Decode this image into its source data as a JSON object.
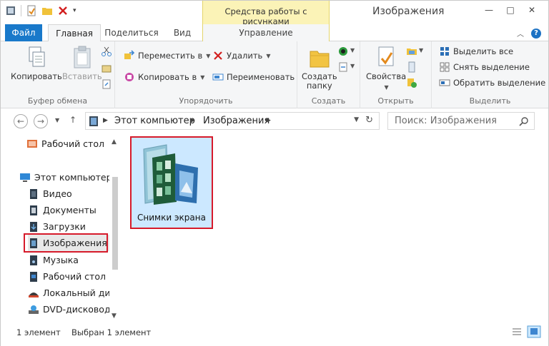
{
  "window": {
    "title": "Изображения"
  },
  "context_tab": {
    "title": "Средства работы с рисунками",
    "tab_label": "Управление"
  },
  "ribbon_tabs": {
    "file": "Файл",
    "home": "Главная",
    "share": "Поделиться",
    "view": "Вид"
  },
  "clipboard": {
    "label": "Буфер обмена",
    "copy": "Копировать",
    "paste": "Вставить"
  },
  "organize": {
    "label": "Упорядочить",
    "move_to": "Переместить в",
    "copy_to": "Копировать в",
    "delete": "Удалить",
    "rename": "Переименовать"
  },
  "create": {
    "label": "Создать",
    "new_folder_line1": "Создать",
    "new_folder_line2": "папку"
  },
  "open": {
    "label": "Открыть",
    "properties": "Свойства"
  },
  "select": {
    "label": "Выделить",
    "select_all": "Выделить все",
    "select_none": "Снять выделение",
    "invert": "Обратить выделение"
  },
  "address": {
    "crumb1": "Этот компьютер",
    "crumb2": "Изображения"
  },
  "search": {
    "placeholder": "Поиск: Изображения"
  },
  "navpane": {
    "items": [
      {
        "label": "Рабочий стол",
        "icon": "desktop-icon"
      },
      {
        "label": "Этот компьютер",
        "icon": "computer-icon"
      },
      {
        "label": "Видео",
        "icon": "video-library-icon"
      },
      {
        "label": "Документы",
        "icon": "documents-library-icon"
      },
      {
        "label": "Загрузки",
        "icon": "downloads-icon"
      },
      {
        "label": "Изображения",
        "icon": "pictures-library-icon"
      },
      {
        "label": "Музыка",
        "icon": "music-library-icon"
      },
      {
        "label": "Рабочий стол",
        "icon": "desktop-icon"
      },
      {
        "label": "Локальный дис",
        "icon": "local-disk-icon"
      },
      {
        "label": "DVD-дисковод",
        "icon": "dvd-drive-icon"
      }
    ]
  },
  "content": {
    "items": [
      {
        "label": "Снимки экрана",
        "icon": "screenshots-folder-icon"
      }
    ]
  },
  "status": {
    "count": "1 элемент",
    "selected": "Выбран 1 элемент"
  },
  "colors": {
    "accent": "#1979ca",
    "context": "#fbf3b7",
    "highlight": "#d61a2a",
    "selection": "#cce8ff"
  }
}
